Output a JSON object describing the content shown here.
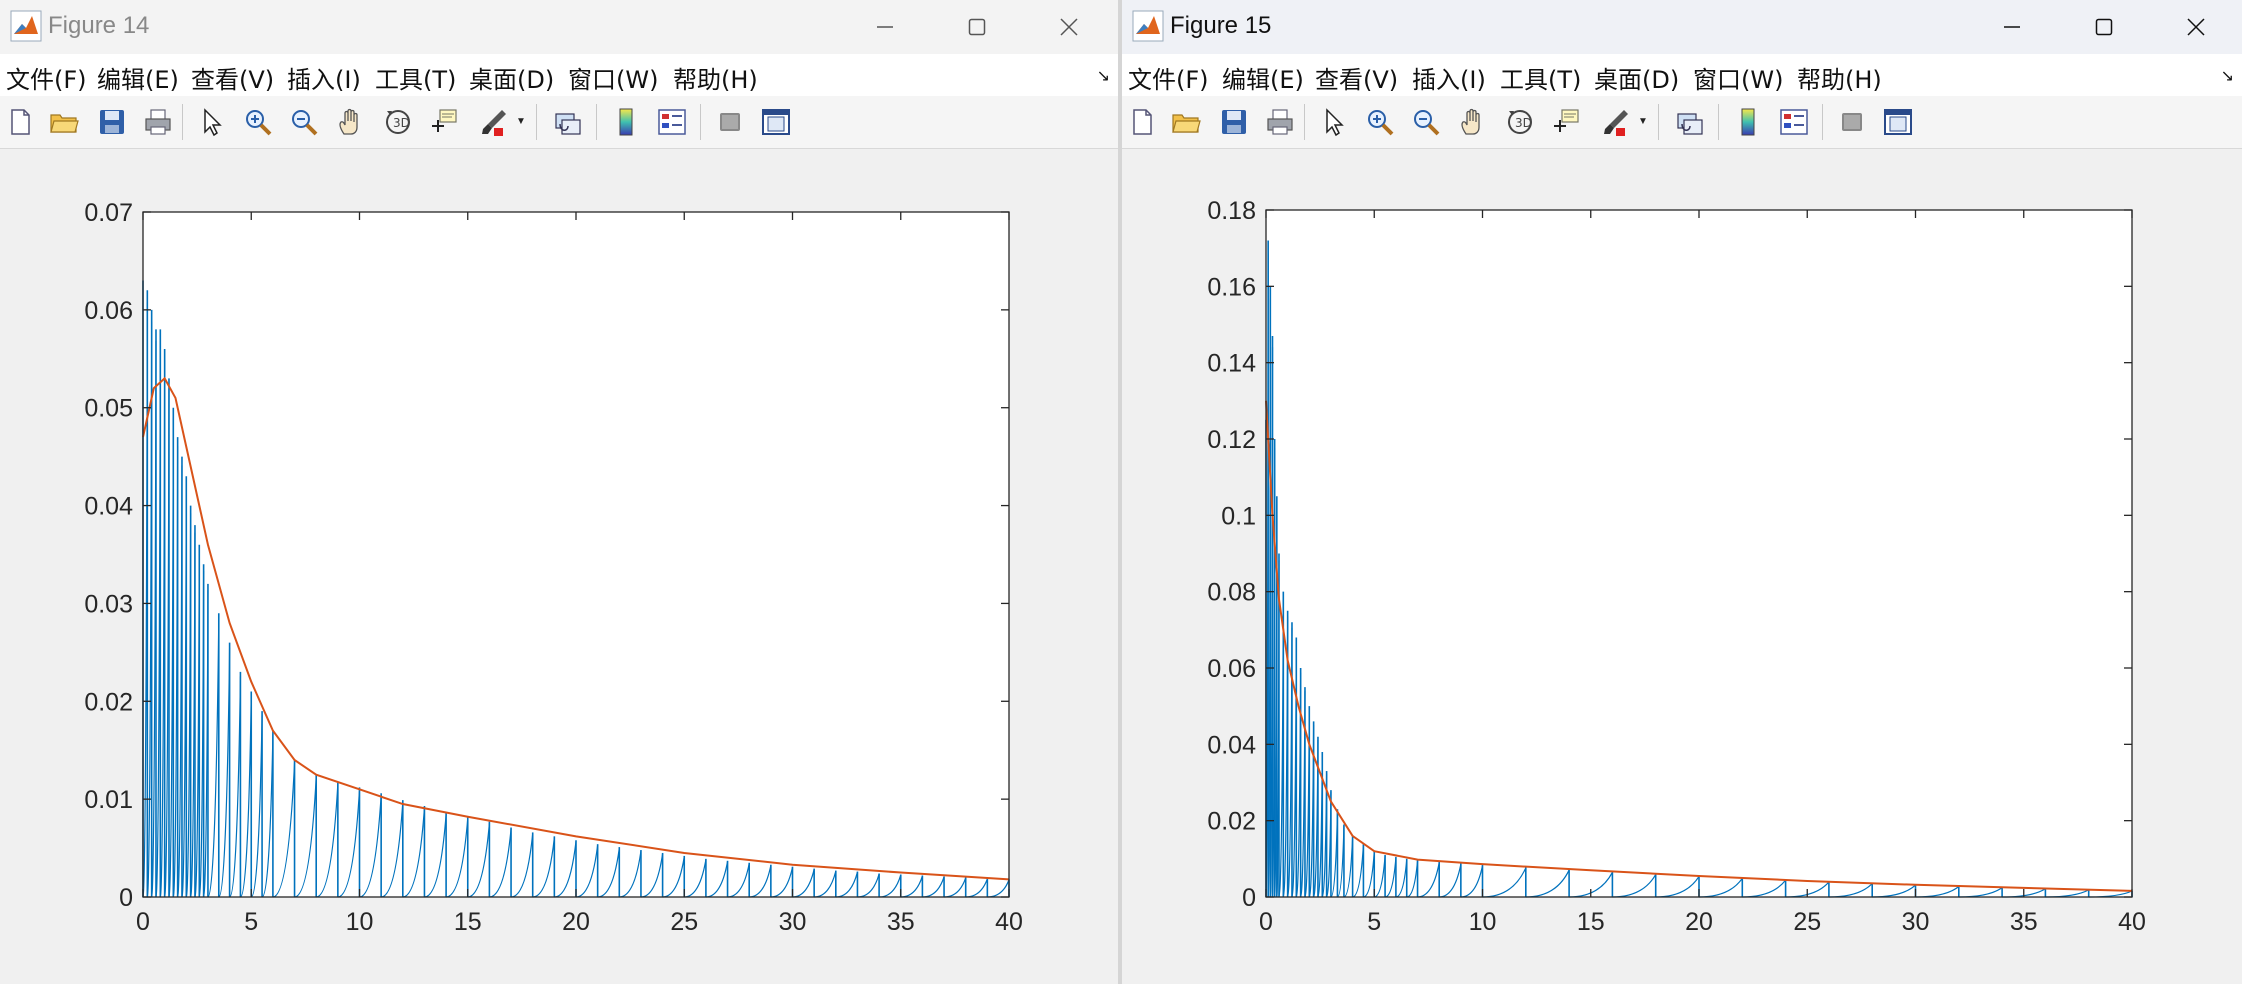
{
  "colors": {
    "stem": "#0072BD",
    "envelope": "#D95319",
    "axis": "#262626",
    "window_bg": "#f0f0f0"
  },
  "windows": [
    {
      "title": "Figure 14",
      "icon": "matlab-logo-icon",
      "controls": [
        "minimize-icon",
        "maximize-icon",
        "close-icon"
      ],
      "menu": [
        "文件(F)",
        "编辑(E)",
        "查看(V)",
        "插入(I)",
        "工具(T)",
        "桌面(D)",
        "窗口(W)",
        "帮助(H)"
      ],
      "toolbar": [
        "new-figure-icon",
        "open-file-icon",
        "save-icon",
        "print-icon",
        "pointer-icon",
        "zoom-in-icon",
        "zoom-out-icon",
        "pan-hand-icon",
        "rotate-3d-icon",
        "data-cursor-icon",
        "brush-icon",
        "link-plot-icon",
        "colorbar-icon",
        "legend-icon",
        "hide-plot-tools-icon",
        "show-plot-tools-icon"
      ]
    },
    {
      "title": "Figure 15",
      "icon": "matlab-logo-icon",
      "controls": [
        "minimize-icon",
        "maximize-icon",
        "close-icon"
      ],
      "menu": [
        "文件(F)",
        "编辑(E)",
        "查看(V)",
        "插入(I)",
        "工具(T)",
        "桌面(D)",
        "窗口(W)",
        "帮助(H)"
      ],
      "toolbar": [
        "new-figure-icon",
        "open-file-icon",
        "save-icon",
        "print-icon",
        "pointer-icon",
        "zoom-in-icon",
        "zoom-out-icon",
        "pan-hand-icon",
        "rotate-3d-icon",
        "data-cursor-icon",
        "brush-icon",
        "link-plot-icon",
        "colorbar-icon",
        "legend-icon",
        "hide-plot-tools-icon",
        "show-plot-tools-icon"
      ]
    }
  ],
  "chart_data": [
    {
      "type": "line",
      "title": "",
      "xlabel": "",
      "ylabel": "",
      "xlim": [
        0,
        40
      ],
      "ylim": [
        0,
        0.07
      ],
      "xticks": [
        "0",
        "5",
        "10",
        "15",
        "20",
        "25",
        "30",
        "35",
        "40"
      ],
      "yticks": [
        "0",
        "0.01",
        "0.02",
        "0.03",
        "0.04",
        "0.05",
        "0.06",
        "0.07"
      ],
      "grid": false,
      "series": [
        {
          "values_note_free": true,
          "style": "stem",
          "x": [
            0,
            0.2,
            0.4,
            0.6,
            0.8,
            1,
            1.2,
            1.4,
            1.6,
            1.8,
            2,
            2.2,
            2.4,
            2.6,
            2.8,
            3,
            3.5,
            4,
            4.5,
            5,
            5.5,
            6,
            7,
            8,
            9,
            10,
            11,
            12,
            13,
            14,
            15,
            16,
            17,
            18,
            19,
            20,
            21,
            22,
            23,
            24,
            25,
            26,
            27,
            28,
            29,
            30,
            31,
            32,
            33,
            34,
            35,
            36,
            37,
            38,
            39,
            40
          ],
          "y": [
            0.063,
            0.062,
            0.06,
            0.058,
            0.058,
            0.056,
            0.053,
            0.05,
            0.047,
            0.045,
            0.043,
            0.04,
            0.038,
            0.036,
            0.034,
            0.032,
            0.029,
            0.026,
            0.023,
            0.021,
            0.019,
            0.017,
            0.014,
            0.0125,
            0.0118,
            0.0112,
            0.0106,
            0.0099,
            0.0093,
            0.0086,
            0.0082,
            0.0077,
            0.0071,
            0.0066,
            0.0062,
            0.0058,
            0.0054,
            0.0051,
            0.0048,
            0.0045,
            0.0042,
            0.0039,
            0.0037,
            0.0035,
            0.0033,
            0.0031,
            0.0029,
            0.0027,
            0.0026,
            0.0024,
            0.0023,
            0.0022,
            0.0021,
            0.002,
            0.0019,
            0.0018
          ]
        },
        {
          "style": "line",
          "x": [
            0,
            0.5,
            1,
            1.5,
            2,
            3,
            4,
            5,
            6,
            7,
            8,
            10,
            12,
            15,
            20,
            25,
            30,
            35,
            40
          ],
          "y": [
            0.047,
            0.052,
            0.053,
            0.051,
            0.046,
            0.036,
            0.028,
            0.022,
            0.017,
            0.014,
            0.0125,
            0.011,
            0.0095,
            0.0082,
            0.0062,
            0.0045,
            0.0033,
            0.0025,
            0.0018
          ]
        }
      ]
    },
    {
      "type": "line",
      "title": "",
      "xlabel": "",
      "ylabel": "",
      "xlim": [
        0,
        40
      ],
      "ylim": [
        0,
        0.18
      ],
      "xticks": [
        "0",
        "5",
        "10",
        "15",
        "20",
        "25",
        "30",
        "35",
        "40"
      ],
      "yticks": [
        "0",
        "0.02",
        "0.04",
        "0.06",
        "0.08",
        "0.1",
        "0.12",
        "0.14",
        "0.16",
        "0.18"
      ],
      "grid": false,
      "series": [
        {
          "style": "stem",
          "x": [
            0,
            0.1,
            0.2,
            0.3,
            0.4,
            0.5,
            0.6,
            0.8,
            1,
            1.2,
            1.4,
            1.6,
            1.8,
            2,
            2.2,
            2.4,
            2.6,
            2.8,
            3,
            3.3,
            3.6,
            4,
            4.5,
            5,
            5.5,
            6,
            6.5,
            7,
            8,
            9,
            10,
            12,
            14,
            16,
            18,
            20,
            22,
            24,
            26,
            28,
            30,
            32,
            34,
            36,
            38,
            40
          ],
          "y": [
            0.125,
            0.172,
            0.16,
            0.147,
            0.12,
            0.105,
            0.09,
            0.08,
            0.075,
            0.072,
            0.068,
            0.06,
            0.055,
            0.05,
            0.046,
            0.042,
            0.038,
            0.033,
            0.028,
            0.023,
            0.019,
            0.016,
            0.014,
            0.012,
            0.011,
            0.0105,
            0.01,
            0.0097,
            0.0092,
            0.0088,
            0.0084,
            0.0078,
            0.0072,
            0.0066,
            0.006,
            0.0055,
            0.005,
            0.0045,
            0.004,
            0.0036,
            0.0032,
            0.0028,
            0.0025,
            0.0022,
            0.0019,
            0.0016
          ]
        },
        {
          "style": "line",
          "x": [
            0,
            0.3,
            0.6,
            1,
            1.5,
            2,
            3,
            4,
            5,
            7,
            10,
            15,
            20,
            25,
            30,
            35,
            40
          ],
          "y": [
            0.13,
            0.1,
            0.078,
            0.062,
            0.05,
            0.04,
            0.025,
            0.016,
            0.012,
            0.0098,
            0.0086,
            0.007,
            0.0055,
            0.0042,
            0.0032,
            0.0024,
            0.0016
          ]
        }
      ]
    }
  ]
}
